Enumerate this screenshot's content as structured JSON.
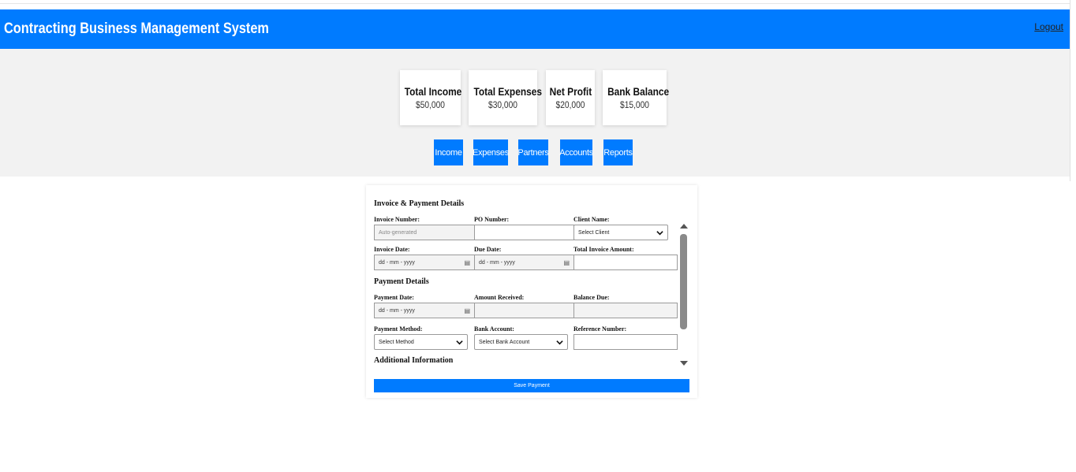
{
  "header": {
    "title": "Contracting Business Management System",
    "logout": "Logout"
  },
  "stats": [
    {
      "label": "Total Income",
      "value": "$50,000"
    },
    {
      "label": "Total Expenses",
      "value": "$30,000"
    },
    {
      "label": "Net Profit",
      "value": "$20,000"
    },
    {
      "label": "Bank Balance",
      "value": "$15,000"
    }
  ],
  "nav": [
    "Income",
    "Expenses",
    "Partners",
    "Accounts",
    "Reports"
  ],
  "form": {
    "section1": "Invoice & Payment Details",
    "invoice_number_label": "Invoice Number:",
    "invoice_number_placeholder": "Auto-generated",
    "po_number_label": "PO Number:",
    "client_name_label": "Client Name:",
    "client_select": "Select Client",
    "invoice_date_label": "Invoice Date:",
    "due_date_label": "Due Date:",
    "total_invoice_label": "Total Invoice Amount:",
    "date_placeholder": "dd - mm - yyyy",
    "section2": "Payment Details",
    "payment_date_label": "Payment Date:",
    "amount_received_label": "Amount Received:",
    "balance_due_label": "Balance Due:",
    "payment_method_label": "Payment Method:",
    "payment_method_select": "Select Method",
    "bank_account_label": "Bank Account:",
    "bank_account_select": "Select Bank Account",
    "reference_number_label": "Reference Number:",
    "section3": "Additional Information",
    "save_button": "Save Payment"
  },
  "colors": {
    "primary": "#007bff",
    "band": "#f2f2f2"
  }
}
